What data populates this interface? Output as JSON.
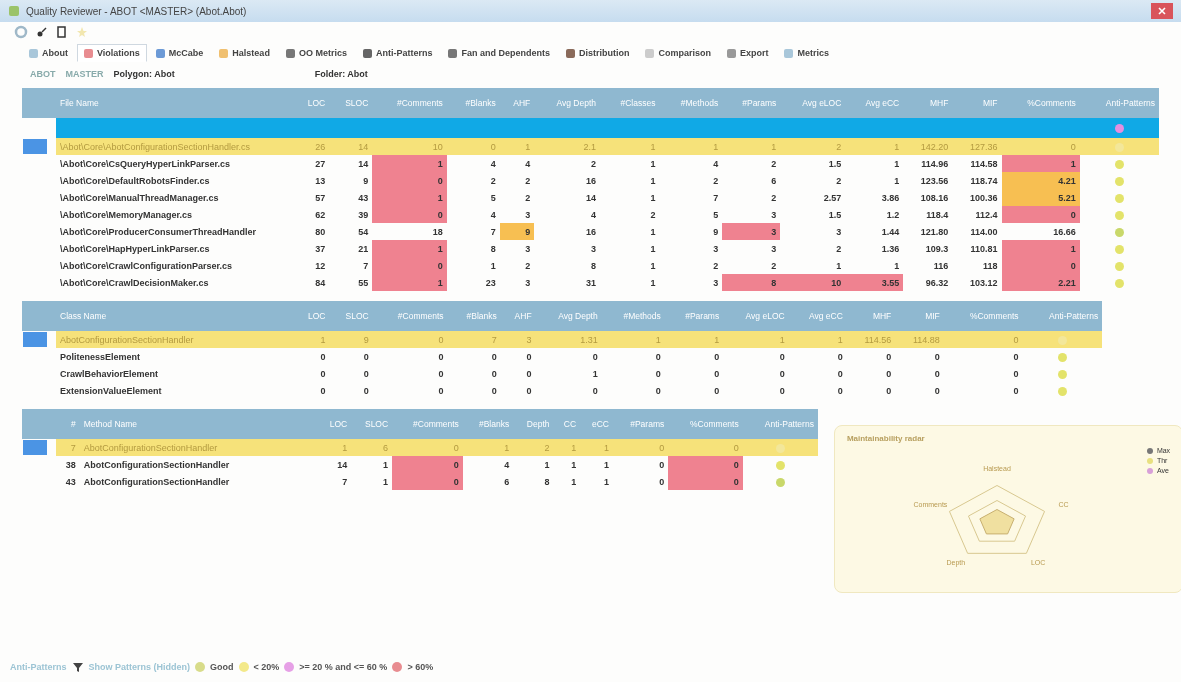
{
  "window": {
    "title": "Quality Reviewer - ABOT <MASTER> (Abot.Abot)"
  },
  "tabs": [
    {
      "label": "About",
      "selected": false
    },
    {
      "label": "Violations",
      "selected": true
    },
    {
      "label": "McCabe",
      "selected": false
    },
    {
      "label": "Halstead",
      "selected": false
    },
    {
      "label": "OO Metrics",
      "selected": false
    },
    {
      "label": "Anti-Patterns",
      "selected": false
    },
    {
      "label": "Fan and Dependents",
      "selected": false
    },
    {
      "label": "Distribution",
      "selected": false
    },
    {
      "label": "Comparison",
      "selected": false
    },
    {
      "label": "Export",
      "selected": false
    },
    {
      "label": "Metrics",
      "selected": false
    }
  ],
  "breadcrumb": {
    "items": [
      "ABOT",
      "MASTER"
    ],
    "polygon": "Polygon: Abot",
    "folder": "Folder: Abot"
  },
  "grids": [
    {
      "filter_dot": {
        "color": "#e58fe0"
      },
      "columns": [
        "File Name",
        "LOC",
        "SLOC",
        "#Comments",
        "#Blanks",
        "AHF",
        "Avg Depth",
        "#Classes",
        "#Methods",
        "#Params",
        "Avg eLOC",
        "Avg eCC",
        "MHF",
        "MIF",
        "%Comments",
        "Anti-Patterns"
      ],
      "rows": [
        {
          "selected": true,
          "color": "#f3e79a",
          "cells": [
            {
              "text": "\\Abot\\Core\\AbotConfigurationSectionHandler.cs"
            },
            {
              "text": "26"
            },
            {
              "text": "14"
            },
            {
              "text": "10"
            },
            {
              "text": "0"
            },
            {
              "text": "1"
            },
            {
              "text": "2.1"
            },
            {
              "text": "1"
            },
            {
              "text": "1"
            },
            {
              "text": "1"
            },
            {
              "text": "2"
            },
            {
              "text": "1"
            },
            {
              "text": "142.20"
            },
            {
              "text": "127.36"
            },
            {
              "text": "0"
            }
          ]
        },
        {
          "selected": false,
          "color": "#e3e36a",
          "cells": [
            {
              "text": "\\Abot\\Core\\CsQueryHyperLinkParser.cs"
            },
            {
              "text": "27"
            },
            {
              "text": "14"
            },
            {
              "text": "1",
              "color": "#ef8290"
            },
            {
              "text": "4"
            },
            {
              "text": "4"
            },
            {
              "text": "2"
            },
            {
              "text": "1"
            },
            {
              "text": "4"
            },
            {
              "text": "2"
            },
            {
              "text": "1.5"
            },
            {
              "text": "1"
            },
            {
              "text": "114.96"
            },
            {
              "text": "114.58"
            },
            {
              "text": "1",
              "color": "#ef8290"
            }
          ]
        },
        {
          "selected": false,
          "color": "#e3e36a",
          "cells": [
            {
              "text": "\\Abot\\Core\\DefaultRobotsFinder.cs"
            },
            {
              "text": "13"
            },
            {
              "text": "9"
            },
            {
              "text": "0",
              "color": "#ef8290"
            },
            {
              "text": "2"
            },
            {
              "text": "2"
            },
            {
              "text": "16"
            },
            {
              "text": "1"
            },
            {
              "text": "2"
            },
            {
              "text": "6"
            },
            {
              "text": "2"
            },
            {
              "text": "1"
            },
            {
              "text": "123.56"
            },
            {
              "text": "118.74"
            },
            {
              "text": "4.21",
              "color": "#f7bf52"
            }
          ]
        },
        {
          "selected": false,
          "color": "#e3e36a",
          "cells": [
            {
              "text": "\\Abot\\Core\\ManualThreadManager.cs"
            },
            {
              "text": "57"
            },
            {
              "text": "43"
            },
            {
              "text": "1",
              "color": "#ef8290"
            },
            {
              "text": "5"
            },
            {
              "text": "2"
            },
            {
              "text": "14"
            },
            {
              "text": "1"
            },
            {
              "text": "7"
            },
            {
              "text": "2"
            },
            {
              "text": "2.57"
            },
            {
              "text": "3.86"
            },
            {
              "text": "108.16"
            },
            {
              "text": "100.36"
            },
            {
              "text": "5.21",
              "color": "#f7bf52"
            }
          ]
        },
        {
          "selected": false,
          "color": "#e3e36a",
          "cells": [
            {
              "text": "\\Abot\\Core\\MemoryManager.cs"
            },
            {
              "text": "62"
            },
            {
              "text": "39"
            },
            {
              "text": "0",
              "color": "#ef8290"
            },
            {
              "text": "4"
            },
            {
              "text": "3"
            },
            {
              "text": "4"
            },
            {
              "text": "2"
            },
            {
              "text": "5"
            },
            {
              "text": "3"
            },
            {
              "text": "1.5"
            },
            {
              "text": "1.2"
            },
            {
              "text": "118.4"
            },
            {
              "text": "112.4"
            },
            {
              "text": "0",
              "color": "#ef8290"
            }
          ]
        },
        {
          "selected": false,
          "color": "#c9d86a",
          "cells": [
            {
              "text": "\\Abot\\Core\\ProducerConsumerThreadHandler"
            },
            {
              "text": "80"
            },
            {
              "text": "54"
            },
            {
              "text": "18"
            },
            {
              "text": "7"
            },
            {
              "text": "9",
              "color": "#f7bf52"
            },
            {
              "text": "16"
            },
            {
              "text": "1"
            },
            {
              "text": "9"
            },
            {
              "text": "3",
              "color": "#ef8290"
            },
            {
              "text": "3"
            },
            {
              "text": "1.44"
            },
            {
              "text": "121.80"
            },
            {
              "text": "114.00"
            },
            {
              "text": "16.66"
            }
          ]
        },
        {
          "selected": false,
          "color": "#e3e36a",
          "cells": [
            {
              "text": "\\Abot\\Core\\HapHyperLinkParser.cs"
            },
            {
              "text": "37"
            },
            {
              "text": "21"
            },
            {
              "text": "1",
              "color": "#ef8290"
            },
            {
              "text": "8"
            },
            {
              "text": "3"
            },
            {
              "text": "3"
            },
            {
              "text": "1"
            },
            {
              "text": "3"
            },
            {
              "text": "3"
            },
            {
              "text": "2"
            },
            {
              "text": "1.36"
            },
            {
              "text": "109.3"
            },
            {
              "text": "110.81"
            },
            {
              "text": "1",
              "color": "#ef8290"
            }
          ]
        },
        {
          "selected": false,
          "color": "#e3e36a",
          "cells": [
            {
              "text": "\\Abot\\Core\\CrawlConfigurationParser.cs"
            },
            {
              "text": "12"
            },
            {
              "text": "7"
            },
            {
              "text": "0",
              "color": "#ef8290"
            },
            {
              "text": "1"
            },
            {
              "text": "2"
            },
            {
              "text": "8"
            },
            {
              "text": "1"
            },
            {
              "text": "2"
            },
            {
              "text": "2"
            },
            {
              "text": "1"
            },
            {
              "text": "1"
            },
            {
              "text": "116"
            },
            {
              "text": "118"
            },
            {
              "text": "0",
              "color": "#ef8290"
            }
          ]
        },
        {
          "selected": false,
          "color": "#e3e36a",
          "cells": [
            {
              "text": "\\Abot\\Core\\CrawlDecisionMaker.cs"
            },
            {
              "text": "84"
            },
            {
              "text": "55"
            },
            {
              "text": "1",
              "color": "#ef8290"
            },
            {
              "text": "23"
            },
            {
              "text": "3"
            },
            {
              "text": "31"
            },
            {
              "text": "1"
            },
            {
              "text": "3"
            },
            {
              "text": "8",
              "color": "#ef8290"
            },
            {
              "text": "10",
              "color": "#ef8290"
            },
            {
              "text": "3.55",
              "color": "#ef8290"
            },
            {
              "text": "96.32"
            },
            {
              "text": "103.12"
            },
            {
              "text": "2.21",
              "color": "#ef8290"
            }
          ]
        }
      ]
    },
    {
      "columns": [
        "Class Name",
        "LOC",
        "SLOC",
        "#Comments",
        "#Blanks",
        "AHF",
        "Avg Depth",
        "#Methods",
        "#Params",
        "Avg eLOC",
        "Avg eCC",
        "MHF",
        "MIF",
        "%Comments",
        "Anti-Patterns"
      ],
      "rows": [
        {
          "selected": true,
          "color": "#f3e79a",
          "cells": [
            {
              "text": "AbotConfigurationSectionHandler"
            },
            {
              "text": "1"
            },
            {
              "text": "9"
            },
            {
              "text": "0"
            },
            {
              "text": "7"
            },
            {
              "text": "3"
            },
            {
              "text": "1.31"
            },
            {
              "text": "1"
            },
            {
              "text": "1"
            },
            {
              "text": "1"
            },
            {
              "text": "1"
            },
            {
              "text": "114.56"
            },
            {
              "text": "114.88"
            },
            {
              "text": "0"
            }
          ]
        },
        {
          "selected": false,
          "color": "#e3e36a",
          "cells": [
            {
              "text": "PolitenessElement"
            },
            {
              "text": "0"
            },
            {
              "text": "0"
            },
            {
              "text": "0"
            },
            {
              "text": "0"
            },
            {
              "text": "0"
            },
            {
              "text": "0"
            },
            {
              "text": "0"
            },
            {
              "text": "0"
            },
            {
              "text": "0"
            },
            {
              "text": "0"
            },
            {
              "text": "0"
            },
            {
              "text": "0"
            },
            {
              "text": "0"
            }
          ]
        },
        {
          "selected": false,
          "color": "#e3e36a",
          "cells": [
            {
              "text": "CrawlBehaviorElement"
            },
            {
              "text": "0"
            },
            {
              "text": "0"
            },
            {
              "text": "0"
            },
            {
              "text": "0"
            },
            {
              "text": "0"
            },
            {
              "text": "1"
            },
            {
              "text": "0"
            },
            {
              "text": "0"
            },
            {
              "text": "0"
            },
            {
              "text": "0"
            },
            {
              "text": "0"
            },
            {
              "text": "0"
            },
            {
              "text": "0"
            }
          ]
        },
        {
          "selected": false,
          "color": "#e3e36a",
          "cells": [
            {
              "text": "ExtensionValueElement"
            },
            {
              "text": "0"
            },
            {
              "text": "0"
            },
            {
              "text": "0"
            },
            {
              "text": "0"
            },
            {
              "text": "0"
            },
            {
              "text": "0"
            },
            {
              "text": "0"
            },
            {
              "text": "0"
            },
            {
              "text": "0"
            },
            {
              "text": "0"
            },
            {
              "text": "0"
            },
            {
              "text": "0"
            },
            {
              "text": "0"
            }
          ]
        }
      ]
    },
    {
      "columns": [
        "#",
        "Method Name",
        "LOC",
        "SLOC",
        "#Comments",
        "#Blanks",
        "Depth",
        "CC",
        "eCC",
        "#Params",
        "%Comments",
        "Anti-Patterns"
      ],
      "rows": [
        {
          "selected": true,
          "color": "#f3e79a",
          "cells": [
            {
              "text": "7"
            },
            {
              "text": "AbotConfigurationSectionHandler"
            },
            {
              "text": "1"
            },
            {
              "text": "6"
            },
            {
              "text": "0"
            },
            {
              "text": "1"
            },
            {
              "text": "2"
            },
            {
              "text": "1"
            },
            {
              "text": "1"
            },
            {
              "text": "0"
            },
            {
              "text": "0"
            }
          ]
        },
        {
          "selected": false,
          "color": "#e3e36a",
          "cells": [
            {
              "text": "38"
            },
            {
              "text": "AbotConfigurationSectionHandler"
            },
            {
              "text": "14"
            },
            {
              "text": "1"
            },
            {
              "text": "0",
              "color": "#ef8290"
            },
            {
              "text": "4"
            },
            {
              "text": "1"
            },
            {
              "text": "1"
            },
            {
              "text": "1"
            },
            {
              "text": "0"
            },
            {
              "text": "0",
              "color": "#ef8290"
            }
          ]
        },
        {
          "selected": false,
          "color": "#c9d86a",
          "cells": [
            {
              "text": "43"
            },
            {
              "text": "AbotConfigurationSectionHandler"
            },
            {
              "text": "7"
            },
            {
              "text": "1"
            },
            {
              "text": "0",
              "color": "#ef8290"
            },
            {
              "text": "6"
            },
            {
              "text": "8"
            },
            {
              "text": "1"
            },
            {
              "text": "1"
            },
            {
              "text": "0"
            },
            {
              "text": "0",
              "color": "#ef8290"
            }
          ]
        }
      ]
    }
  ],
  "radar": {
    "title": "Maintainability radar",
    "axes": [
      "Halstead",
      "CC",
      "LOC",
      "Depth",
      "Comments"
    ],
    "legend": [
      {
        "label": "Max",
        "color": "#777777"
      },
      {
        "label": "Thr",
        "color": "#e8e080"
      },
      {
        "label": "Ave",
        "color": "#d8a0d8"
      }
    ]
  },
  "footer": {
    "link": "Anti-Patterns",
    "hidden_link": "Show Patterns (Hidden)",
    "legend": [
      {
        "label": "Good",
        "color": "#d8dc8a"
      },
      {
        "label": "< 20%",
        "color": "#f3e98a"
      },
      {
        "label": ">= 20 % and <= 60 %",
        "color": "#e6a0e6"
      },
      {
        "label": "> 60%",
        "color": "#e88c90"
      }
    ]
  }
}
